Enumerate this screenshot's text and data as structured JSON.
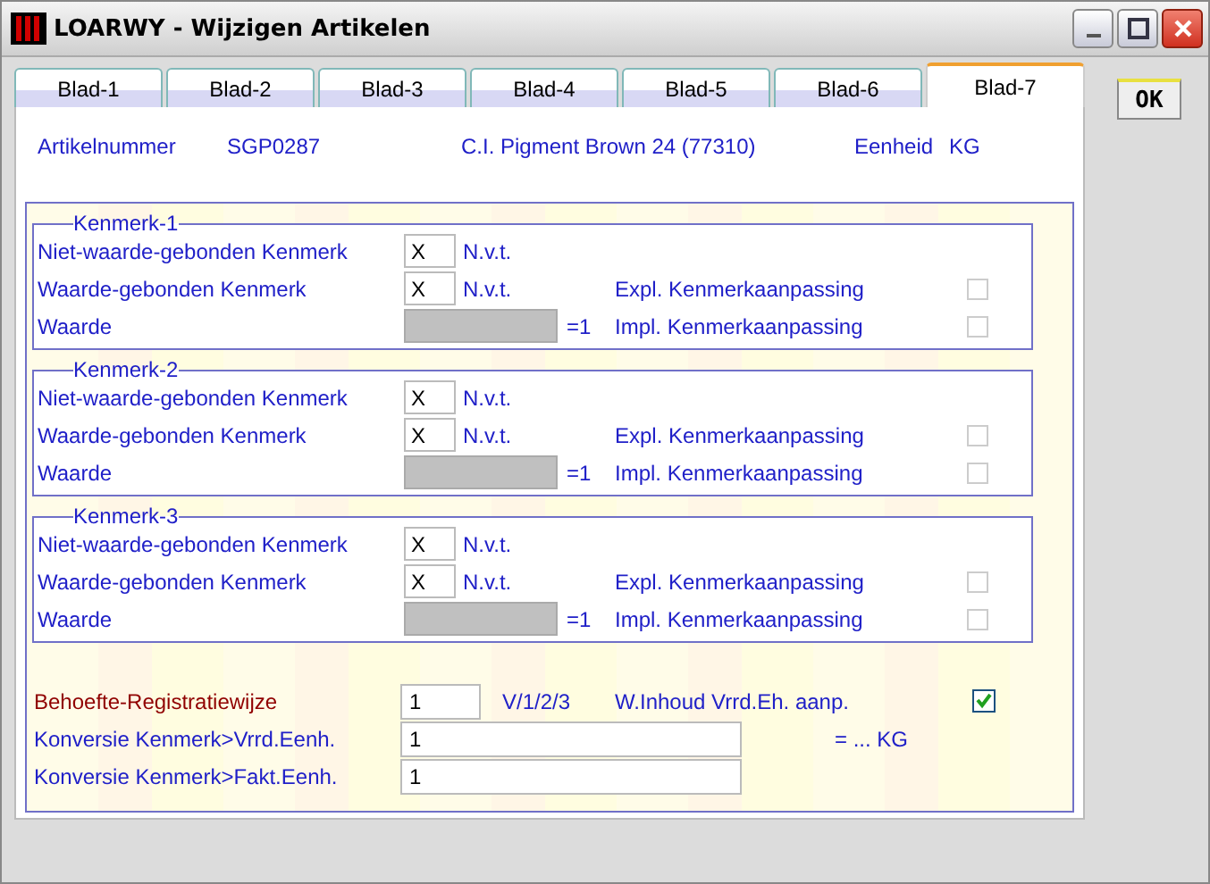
{
  "window": {
    "title": "LOARWY - Wijzigen Artikelen"
  },
  "tabs": [
    {
      "label": "Blad-1",
      "selected": false
    },
    {
      "label": "Blad-2",
      "selected": false
    },
    {
      "label": "Blad-3",
      "selected": false
    },
    {
      "label": "Blad-4",
      "selected": false
    },
    {
      "label": "Blad-5",
      "selected": false
    },
    {
      "label": "Blad-6",
      "selected": false
    },
    {
      "label": "Blad-7",
      "selected": true
    }
  ],
  "ok_button": "OK",
  "header": {
    "label": "Artikelnummer",
    "code": "SGP0287",
    "description": "C.I. Pigment Brown 24 (77310)",
    "unit_label": "Eenheid",
    "unit": "KG"
  },
  "kenmerken": [
    {
      "title": "Kenmerk-1",
      "niet_waarde_label": "Niet-waarde-gebonden Kenmerk",
      "niet_waarde_value": "X",
      "niet_waarde_note": "N.v.t.",
      "waarde_gebonden_label": "Waarde-gebonden Kenmerk",
      "waarde_gebonden_value": "X",
      "waarde_gebonden_note": "N.v.t.",
      "expl_label": "Expl. Kenmerkaanpassing",
      "expl_checked": false,
      "waarde_label": "Waarde",
      "waarde_disabled": true,
      "waarde_suffix": "=1",
      "impl_label": "Impl. Kenmerkaanpassing",
      "impl_checked": false
    },
    {
      "title": "Kenmerk-2",
      "niet_waarde_label": "Niet-waarde-gebonden Kenmerk",
      "niet_waarde_value": "X",
      "niet_waarde_note": "N.v.t.",
      "waarde_gebonden_label": "Waarde-gebonden Kenmerk",
      "waarde_gebonden_value": "X",
      "waarde_gebonden_note": "N.v.t.",
      "expl_label": "Expl. Kenmerkaanpassing",
      "expl_checked": false,
      "waarde_label": "Waarde",
      "waarde_disabled": true,
      "waarde_suffix": "=1",
      "impl_label": "Impl. Kenmerkaanpassing",
      "impl_checked": false
    },
    {
      "title": "Kenmerk-3",
      "niet_waarde_label": "Niet-waarde-gebonden Kenmerk",
      "niet_waarde_value": "X",
      "niet_waarde_note": "N.v.t.",
      "waarde_gebonden_label": "Waarde-gebonden Kenmerk",
      "waarde_gebonden_value": "X",
      "waarde_gebonden_note": "N.v.t.",
      "expl_label": "Expl. Kenmerkaanpassing",
      "expl_checked": false,
      "waarde_label": "Waarde",
      "waarde_disabled": true,
      "waarde_suffix": "=1",
      "impl_label": "Impl. Kenmerkaanpassing",
      "impl_checked": false
    }
  ],
  "registratie": {
    "label": "Behoefte-Registratiewijze",
    "value": "1",
    "hint": "V/1/2/3",
    "inhoud_label": "W.Inhoud Vrrd.Eh. aanp.",
    "inhoud_checked": true
  },
  "conversies": [
    {
      "label": "Konversie Kenmerk>Vrrd.Eenh.",
      "value": "1",
      "note": "= ... KG"
    },
    {
      "label": "Konversie Kenmerk>Fakt.Eenh.",
      "value": "1"
    }
  ]
}
